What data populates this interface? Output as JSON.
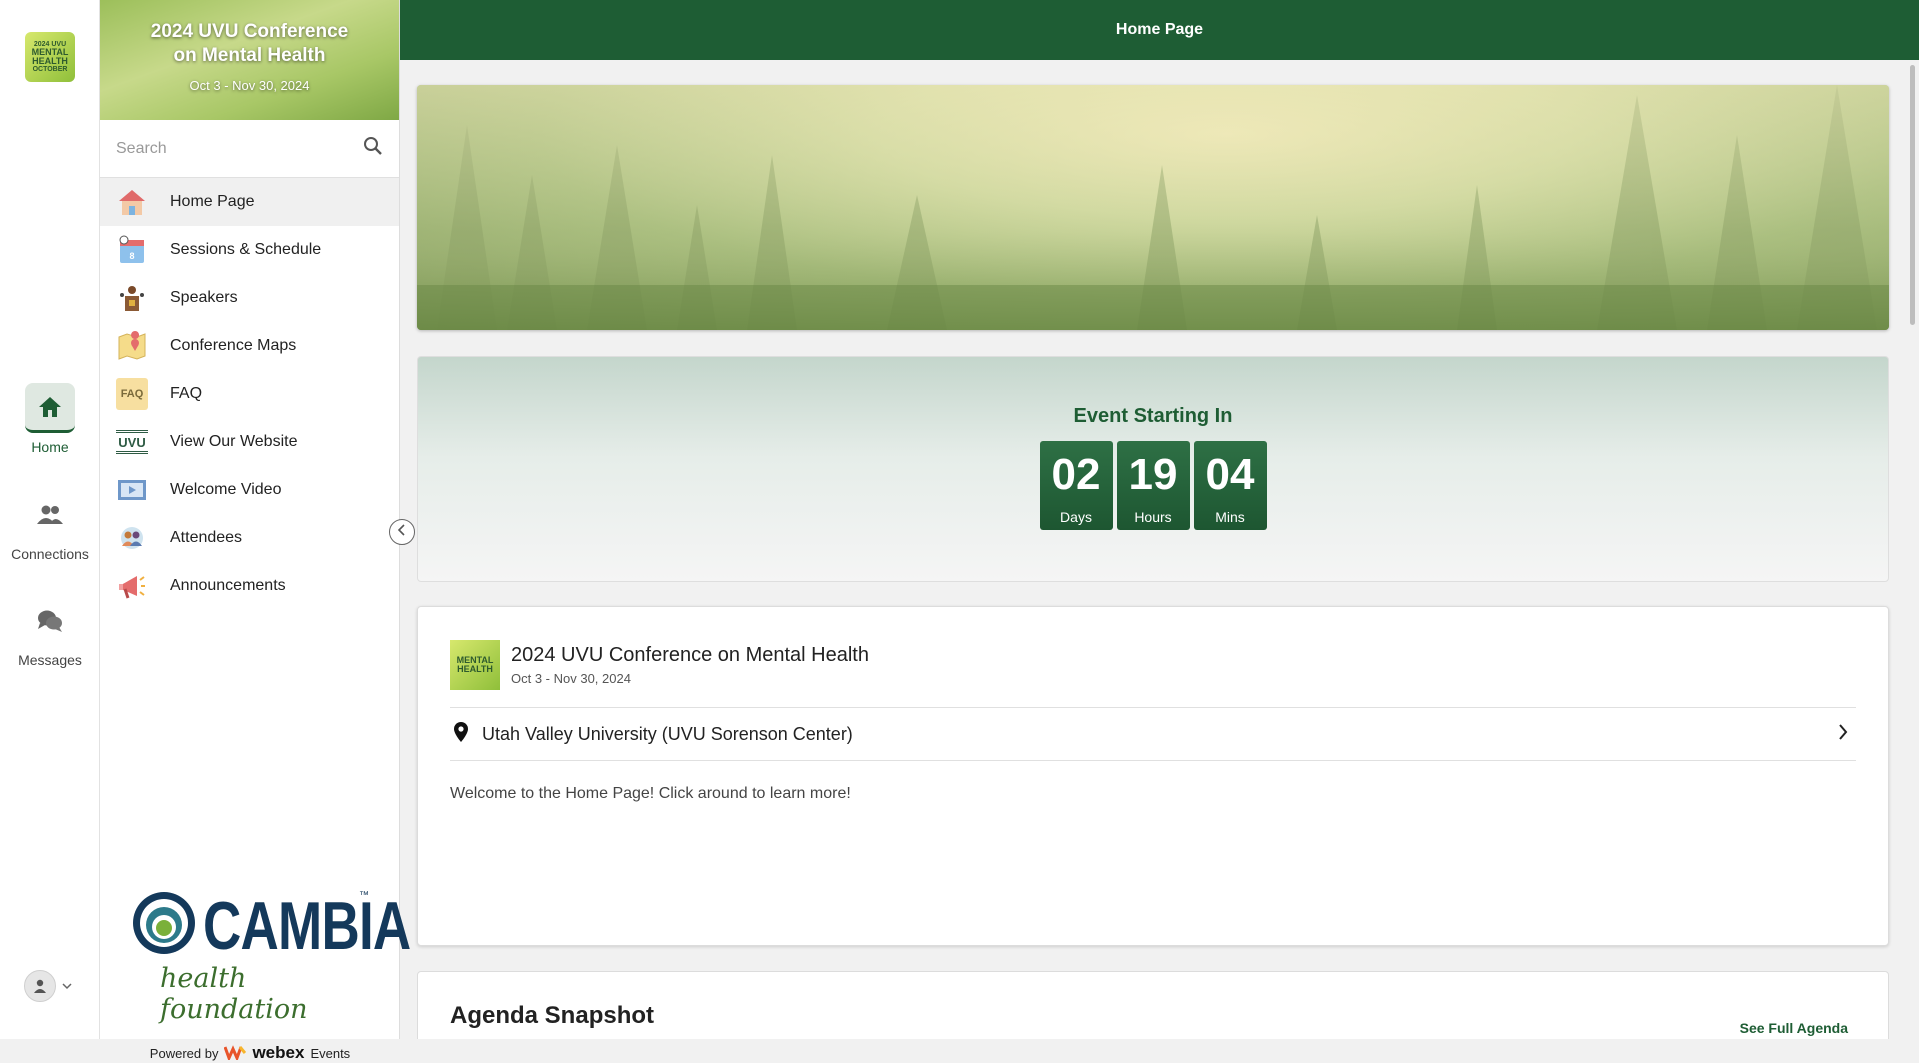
{
  "rail": {
    "logo_text": [
      "2024 UVU",
      "MENTAL",
      "HEALTH",
      "OCTOBER"
    ],
    "items": [
      {
        "label": "Home",
        "icon": "home-icon"
      },
      {
        "label": "Connections",
        "icon": "people-icon"
      },
      {
        "label": "Messages",
        "icon": "chat-icon"
      }
    ]
  },
  "sidebar": {
    "event_title": "2024 UVU Conference on Mental Health",
    "event_dates": "Oct 3 - Nov 30, 2024",
    "search_placeholder": "Search",
    "items": [
      {
        "label": "Home Page",
        "icon": "house-icon"
      },
      {
        "label": "Sessions & Schedule",
        "icon": "calendar-icon"
      },
      {
        "label": "Speakers",
        "icon": "podium-icon"
      },
      {
        "label": "Conference Maps",
        "icon": "map-icon"
      },
      {
        "label": "FAQ",
        "icon": "faq-icon"
      },
      {
        "label": "View Our Website",
        "icon": "website-icon"
      },
      {
        "label": "Welcome Video",
        "icon": "video-icon"
      },
      {
        "label": "Attendees",
        "icon": "attendees-icon"
      },
      {
        "label": "Announcements",
        "icon": "megaphone-icon"
      }
    ],
    "sponsor": {
      "name": "CAMBIA",
      "tm": "™",
      "sub": "health foundation"
    },
    "powered_by": "Powered by",
    "powered_brand": "webex",
    "powered_brand_suffix": "Events"
  },
  "topbar": {
    "title": "Home Page"
  },
  "countdown": {
    "title": "Event Starting In",
    "units": [
      {
        "value": "02",
        "label": "Days"
      },
      {
        "value": "19",
        "label": "Hours"
      },
      {
        "value": "04",
        "label": "Mins"
      }
    ]
  },
  "info": {
    "name": "2024 UVU Conference on Mental Health",
    "dates": "Oct 3 - Nov 30, 2024",
    "location": "Utah Valley University (UVU Sorenson Center)",
    "welcome": "Welcome to the Home Page! Click around to learn more!",
    "logo_text": [
      "MENTAL",
      "HEALTH"
    ]
  },
  "agenda": {
    "title": "Agenda Snapshot",
    "link": "See Full Agenda"
  },
  "colors": {
    "brand": "#1e5d34"
  }
}
